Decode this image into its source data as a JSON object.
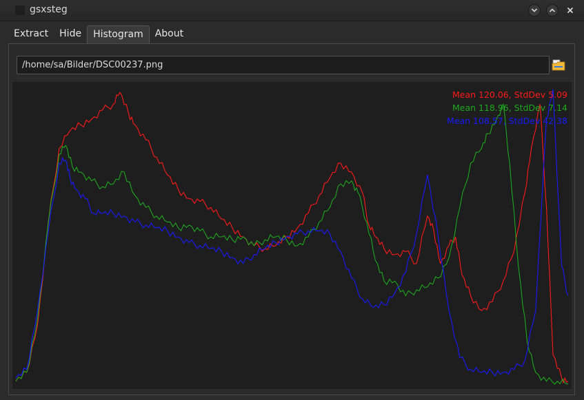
{
  "window": {
    "title": "gsxsteg"
  },
  "tabs": [
    {
      "label": "Extract"
    },
    {
      "label": "Hide"
    },
    {
      "label": "Histogram",
      "active": true
    },
    {
      "label": "About"
    }
  ],
  "file": {
    "path": "/home/sa/Bilder/DSC00237.png"
  },
  "icons": {
    "open_file": "folder-open-icon",
    "minimize": "chevron-down-icon",
    "maximize": "chevron-up-icon",
    "close": "close-icon"
  },
  "colors": {
    "red": "#ff1a1a",
    "green": "#1fa81f",
    "blue": "#1a1aff",
    "background": "#1e1e1e"
  },
  "chart_data": {
    "type": "line",
    "x_range": [
      0,
      255
    ],
    "stats": [
      {
        "channel": "red",
        "text": "Mean 120.06, StdDev 5.09"
      },
      {
        "channel": "green",
        "text": "Mean 118.96, StdDev 7.14"
      },
      {
        "channel": "blue",
        "text": "Mean 108.57, StdDev 42.38"
      }
    ],
    "series": [
      {
        "channel": "red",
        "points": [
          [
            0,
            0.01
          ],
          [
            5,
            0.04
          ],
          [
            10,
            0.2
          ],
          [
            15,
            0.55
          ],
          [
            20,
            0.8
          ],
          [
            25,
            0.86
          ],
          [
            30,
            0.88
          ],
          [
            35,
            0.9
          ],
          [
            40,
            0.93
          ],
          [
            45,
            0.95
          ],
          [
            48,
            0.99
          ],
          [
            52,
            0.92
          ],
          [
            55,
            0.88
          ],
          [
            60,
            0.83
          ],
          [
            65,
            0.77
          ],
          [
            70,
            0.71
          ],
          [
            75,
            0.66
          ],
          [
            80,
            0.63
          ],
          [
            85,
            0.62
          ],
          [
            90,
            0.6
          ],
          [
            95,
            0.56
          ],
          [
            100,
            0.53
          ],
          [
            105,
            0.5
          ],
          [
            110,
            0.47
          ],
          [
            115,
            0.46
          ],
          [
            120,
            0.47
          ],
          [
            125,
            0.5
          ],
          [
            130,
            0.53
          ],
          [
            135,
            0.58
          ],
          [
            140,
            0.64
          ],
          [
            145,
            0.7
          ],
          [
            150,
            0.75
          ],
          [
            155,
            0.72
          ],
          [
            160,
            0.65
          ],
          [
            163,
            0.54
          ],
          [
            166,
            0.5
          ],
          [
            170,
            0.46
          ],
          [
            175,
            0.44
          ],
          [
            180,
            0.45
          ],
          [
            185,
            0.41
          ],
          [
            190,
            0.57
          ],
          [
            193,
            0.52
          ],
          [
            196,
            0.41
          ],
          [
            200,
            0.47
          ],
          [
            203,
            0.5
          ],
          [
            206,
            0.37
          ],
          [
            210,
            0.3
          ],
          [
            215,
            0.25
          ],
          [
            220,
            0.28
          ],
          [
            225,
            0.35
          ],
          [
            230,
            0.45
          ],
          [
            235,
            0.65
          ],
          [
            238,
            0.8
          ],
          [
            242,
            0.95
          ],
          [
            245,
            0.6
          ],
          [
            248,
            0.1
          ],
          [
            252,
            0.02
          ],
          [
            255,
            0.01
          ]
        ]
      },
      {
        "channel": "green",
        "points": [
          [
            0,
            0.01
          ],
          [
            5,
            0.04
          ],
          [
            10,
            0.22
          ],
          [
            15,
            0.55
          ],
          [
            20,
            0.78
          ],
          [
            23,
            0.81
          ],
          [
            26,
            0.74
          ],
          [
            30,
            0.72
          ],
          [
            35,
            0.69
          ],
          [
            40,
            0.67
          ],
          [
            45,
            0.68
          ],
          [
            50,
            0.72
          ],
          [
            55,
            0.64
          ],
          [
            60,
            0.6
          ],
          [
            65,
            0.57
          ],
          [
            70,
            0.55
          ],
          [
            75,
            0.53
          ],
          [
            80,
            0.54
          ],
          [
            85,
            0.52
          ],
          [
            90,
            0.5
          ],
          [
            95,
            0.5
          ],
          [
            100,
            0.49
          ],
          [
            105,
            0.5
          ],
          [
            110,
            0.47
          ],
          [
            115,
            0.49
          ],
          [
            120,
            0.5
          ],
          [
            125,
            0.49
          ],
          [
            130,
            0.47
          ],
          [
            135,
            0.5
          ],
          [
            140,
            0.55
          ],
          [
            145,
            0.6
          ],
          [
            150,
            0.68
          ],
          [
            155,
            0.69
          ],
          [
            158,
            0.65
          ],
          [
            162,
            0.55
          ],
          [
            166,
            0.42
          ],
          [
            170,
            0.35
          ],
          [
            175,
            0.35
          ],
          [
            180,
            0.3
          ],
          [
            185,
            0.32
          ],
          [
            190,
            0.33
          ],
          [
            195,
            0.36
          ],
          [
            200,
            0.43
          ],
          [
            205,
            0.6
          ],
          [
            210,
            0.75
          ],
          [
            215,
            0.8
          ],
          [
            218,
            0.85
          ],
          [
            222,
            0.9
          ],
          [
            225,
            0.95
          ],
          [
            228,
            0.75
          ],
          [
            232,
            0.4
          ],
          [
            236,
            0.15
          ],
          [
            240,
            0.04
          ],
          [
            245,
            0.01
          ],
          [
            250,
            0.01
          ],
          [
            255,
            0.0
          ]
        ]
      },
      {
        "channel": "blue",
        "points": [
          [
            0,
            0.02
          ],
          [
            5,
            0.05
          ],
          [
            10,
            0.25
          ],
          [
            15,
            0.52
          ],
          [
            20,
            0.75
          ],
          [
            23,
            0.76
          ],
          [
            25,
            0.7
          ],
          [
            28,
            0.66
          ],
          [
            32,
            0.63
          ],
          [
            36,
            0.58
          ],
          [
            40,
            0.58
          ],
          [
            45,
            0.58
          ],
          [
            50,
            0.57
          ],
          [
            55,
            0.55
          ],
          [
            60,
            0.54
          ],
          [
            65,
            0.53
          ],
          [
            70,
            0.52
          ],
          [
            75,
            0.5
          ],
          [
            80,
            0.48
          ],
          [
            85,
            0.47
          ],
          [
            90,
            0.46
          ],
          [
            95,
            0.45
          ],
          [
            100,
            0.43
          ],
          [
            105,
            0.41
          ],
          [
            110,
            0.44
          ],
          [
            115,
            0.46
          ],
          [
            120,
            0.48
          ],
          [
            125,
            0.5
          ],
          [
            130,
            0.51
          ],
          [
            135,
            0.52
          ],
          [
            140,
            0.52
          ],
          [
            145,
            0.51
          ],
          [
            150,
            0.45
          ],
          [
            155,
            0.36
          ],
          [
            160,
            0.29
          ],
          [
            165,
            0.26
          ],
          [
            170,
            0.27
          ],
          [
            175,
            0.31
          ],
          [
            180,
            0.38
          ],
          [
            185,
            0.51
          ],
          [
            190,
            0.71
          ],
          [
            195,
            0.5
          ],
          [
            200,
            0.25
          ],
          [
            205,
            0.09
          ],
          [
            210,
            0.05
          ],
          [
            215,
            0.04
          ],
          [
            220,
            0.04
          ],
          [
            225,
            0.04
          ],
          [
            230,
            0.05
          ],
          [
            235,
            0.08
          ],
          [
            240,
            0.25
          ],
          [
            245,
            0.9
          ],
          [
            248,
            1.0
          ],
          [
            252,
            0.4
          ],
          [
            255,
            0.3
          ]
        ]
      }
    ]
  }
}
